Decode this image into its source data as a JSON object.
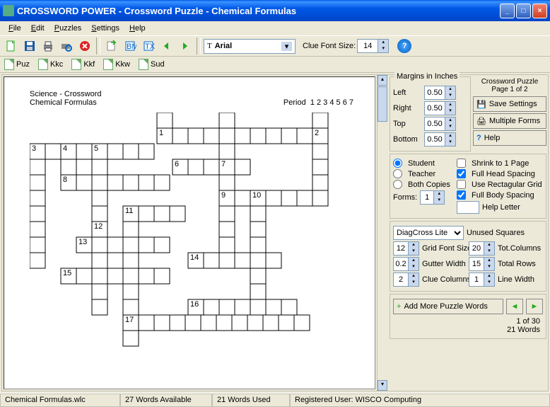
{
  "window": {
    "title": "CROSSWORD POWER - Crossword Puzzle - Chemical Formulas"
  },
  "menu": {
    "file": "File",
    "edit": "Edit",
    "puzzles": "Puzzles",
    "settings": "Settings",
    "help": "Help"
  },
  "toolbar": {
    "font": "Arial",
    "clueFontLabel": "Clue Font Size:",
    "clueFontSize": "14"
  },
  "filetypes": {
    "puz": "Puz",
    "kkc": "Kkc",
    "kkf": "Kkf",
    "kkw": "Kkw",
    "sud": "Sud"
  },
  "puzzle": {
    "category": "Science - Crossword",
    "title": "Chemical Formulas",
    "periodLabel": "Period",
    "periods": "1  2  3  4  5  6  7"
  },
  "margins": {
    "title": "Margins in Inches",
    "left": "Left",
    "right": "Right",
    "top": "Top",
    "bottom": "Bottom",
    "leftVal": "0.50",
    "rightVal": "0.50",
    "topVal": "0.50",
    "bottomVal": "0.50"
  },
  "side": {
    "pageLabel": "Crossword Puzzle Page 1 of 2",
    "saveSettings": "Save Settings",
    "multipleForms": "Multiple Forms",
    "help": "Help",
    "student": "Student",
    "teacher": "Teacher",
    "both": "Both Copies",
    "formsLabel": "Forms:",
    "formsVal": "1",
    "shrink": "Shrink to 1 Page",
    "fullHead": "Full Head Spacing",
    "rectGrid": "Use Rectagular Grid",
    "fullBody": "Full Body Spacing",
    "helpLetter": "Help Letter",
    "diagCross": "DiagCross Lite",
    "unusedSq": "Unused Squares",
    "gridFont": "Grid Font Size",
    "gridFontVal": "12",
    "totCols": "Tot.Columns",
    "totColsVal": "20",
    "gutter": "Gutter Width",
    "gutterVal": "0.2",
    "totRows": "Total Rows",
    "totRowsVal": "15",
    "clueCols": "Clue Columns",
    "clueColsVal": "2",
    "lineWidth": "Line Width",
    "lineWidthVal": "1",
    "addWords": "Add More Puzzle Words",
    "pageInfo": "1 of 30",
    "wordCount": "21 Words"
  },
  "status": {
    "file": "Chemical Formulas.wlc",
    "avail": "27 Words Available",
    "used": "21 Words Used",
    "reg": "Registered User:  WISCO Computing"
  }
}
